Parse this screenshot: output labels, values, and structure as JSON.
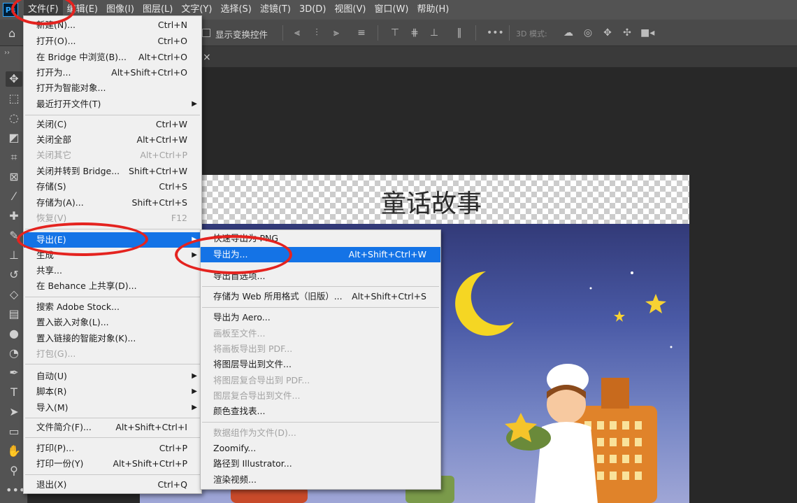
{
  "app": {
    "logo": "Ps"
  },
  "menubar": {
    "items": [
      "文件(F)",
      "编辑(E)",
      "图像(I)",
      "图层(L)",
      "文字(Y)",
      "选择(S)",
      "滤镜(T)",
      "3D(D)",
      "视图(V)",
      "窗口(W)",
      "帮助(H)"
    ]
  },
  "options_bar": {
    "home_icon": "home-icon",
    "show_transform_label": "显示变换控件",
    "mode_3d_label": "3D 模式:",
    "more_label": "•••"
  },
  "document": {
    "tab_close": "×",
    "title_text": "童话故事"
  },
  "file_menu": {
    "items": [
      {
        "label": "新建(N)...",
        "shortcut": "Ctrl+N"
      },
      {
        "label": "打开(O)...",
        "shortcut": "Ctrl+O"
      },
      {
        "label": "在 Bridge 中浏览(B)...",
        "shortcut": "Alt+Ctrl+O"
      },
      {
        "label": "打开为...",
        "shortcut": "Alt+Shift+Ctrl+O"
      },
      {
        "label": "打开为智能对象...",
        "shortcut": ""
      },
      {
        "label": "最近打开文件(T)",
        "shortcut": "",
        "submenu": true
      },
      {
        "label": "关闭(C)",
        "shortcut": "Ctrl+W"
      },
      {
        "label": "关闭全部",
        "shortcut": "Alt+Ctrl+W"
      },
      {
        "label": "关闭其它",
        "shortcut": "Alt+Ctrl+P",
        "disabled": true
      },
      {
        "label": "关闭并转到 Bridge...",
        "shortcut": "Shift+Ctrl+W"
      },
      {
        "label": "存储(S)",
        "shortcut": "Ctrl+S"
      },
      {
        "label": "存储为(A)...",
        "shortcut": "Shift+Ctrl+S"
      },
      {
        "label": "恢复(V)",
        "shortcut": "F12",
        "disabled": true
      },
      {
        "label": "导出(E)",
        "shortcut": "",
        "submenu": true,
        "highlighted": true
      },
      {
        "label": "生成",
        "shortcut": "",
        "submenu": true
      },
      {
        "label": "共享...",
        "shortcut": ""
      },
      {
        "label": "在 Behance 上共享(D)...",
        "shortcut": ""
      },
      {
        "label": "搜索 Adobe Stock...",
        "shortcut": ""
      },
      {
        "label": "置入嵌入对象(L)...",
        "shortcut": ""
      },
      {
        "label": "置入链接的智能对象(K)...",
        "shortcut": ""
      },
      {
        "label": "打包(G)...",
        "shortcut": "",
        "disabled": true
      },
      {
        "label": "自动(U)",
        "shortcut": "",
        "submenu": true
      },
      {
        "label": "脚本(R)",
        "shortcut": "",
        "submenu": true
      },
      {
        "label": "导入(M)",
        "shortcut": "",
        "submenu": true
      },
      {
        "label": "文件简介(F)...",
        "shortcut": "Alt+Shift+Ctrl+I"
      },
      {
        "label": "打印(P)...",
        "shortcut": "Ctrl+P"
      },
      {
        "label": "打印一份(Y)",
        "shortcut": "Alt+Shift+Ctrl+P"
      },
      {
        "label": "退出(X)",
        "shortcut": "Ctrl+Q"
      }
    ]
  },
  "export_menu": {
    "items": [
      {
        "label": "快速导出为 PNG",
        "shortcut": ""
      },
      {
        "label": "导出为...",
        "shortcut": "Alt+Shift+Ctrl+W",
        "highlighted": true
      },
      {
        "label": "导出首选项...",
        "shortcut": ""
      },
      {
        "label": "存储为 Web 所用格式（旧版）...",
        "shortcut": "Alt+Shift+Ctrl+S"
      },
      {
        "label": "导出为 Aero...",
        "shortcut": ""
      },
      {
        "label": "画板至文件...",
        "shortcut": "",
        "disabled": true
      },
      {
        "label": "将画板导出到 PDF...",
        "shortcut": "",
        "disabled": true
      },
      {
        "label": "将图层导出到文件...",
        "shortcut": ""
      },
      {
        "label": "将图层复合导出到 PDF...",
        "shortcut": "",
        "disabled": true
      },
      {
        "label": "图层复合导出到文件...",
        "shortcut": "",
        "disabled": true
      },
      {
        "label": "颜色查找表...",
        "shortcut": ""
      },
      {
        "label": "数据组作为文件(D)...",
        "shortcut": "",
        "disabled": true
      },
      {
        "label": "Zoomify...",
        "shortcut": ""
      },
      {
        "label": "路径到 Illustrator...",
        "shortcut": ""
      },
      {
        "label": "渲染视频...",
        "shortcut": ""
      }
    ]
  },
  "colors": {
    "highlight": "#1473e6",
    "annotation": "#e4231f",
    "menubar": "#535353"
  }
}
